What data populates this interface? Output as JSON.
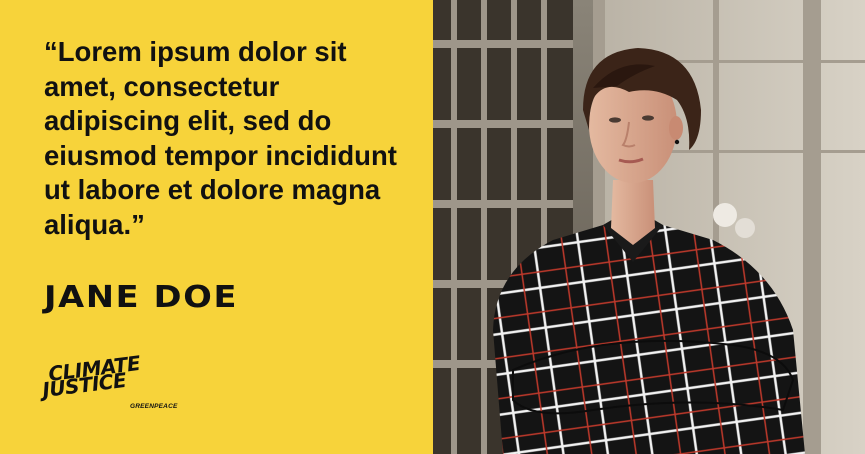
{
  "quote": {
    "text": "“Lorem ipsum dolor sit amet, consectetur adipiscing elit, sed do eiusmod tempor incididunt ut labore et dolore magna aliqua.”"
  },
  "person": {
    "name": "JANE DOE"
  },
  "logo": {
    "line1": "CLIMATE",
    "line2": "JUSTICE",
    "org": "GREENPEACE"
  },
  "colors": {
    "background": "#f7d33a",
    "text": "#111111"
  }
}
